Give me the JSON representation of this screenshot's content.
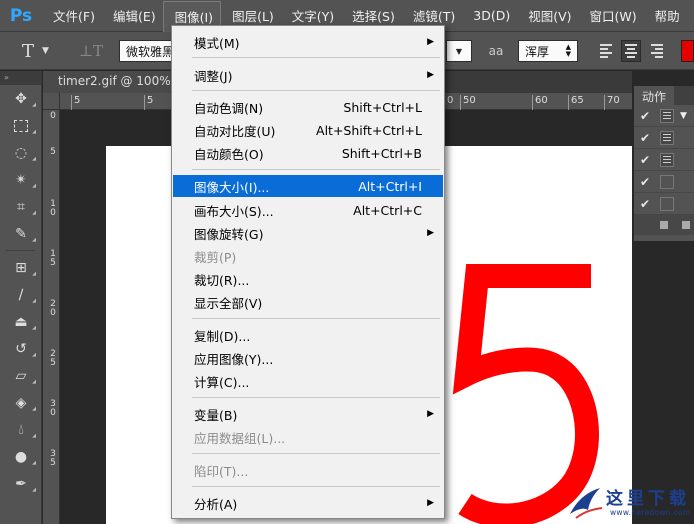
{
  "app": {
    "logo": "Ps"
  },
  "menubar": {
    "items": [
      "文件(F)",
      "编辑(E)",
      "图像(I)",
      "图层(L)",
      "文字(Y)",
      "选择(S)",
      "滤镜(T)",
      "3D(D)",
      "视图(V)",
      "窗口(W)",
      "帮助"
    ],
    "active_index": 2
  },
  "options_bar": {
    "tool_glyph": "T",
    "font_family": "微软雅黑",
    "antialias_label": "aa",
    "antialias_value": "浑厚",
    "text_color": "#e60000"
  },
  "document": {
    "tab_title": "timer2.gif @ 100%",
    "ruler_top_labels": [
      "5",
      "5",
      "5",
      "0",
      "50",
      "55",
      "60",
      "65",
      "70"
    ],
    "ruler_left_labels": [
      "0",
      "5",
      "1\n0",
      "1\n5",
      "2\n0",
      "2\n5",
      "3\n0",
      "3\n5"
    ],
    "canvas_digit": "5",
    "digit_color": "#ff0000"
  },
  "actions_panel": {
    "tab_label": "动作",
    "rows": [
      {
        "checked": true,
        "has_box": true,
        "expand": true
      },
      {
        "checked": true,
        "has_box": true,
        "expand": false
      },
      {
        "checked": true,
        "has_box": true,
        "expand": false
      },
      {
        "checked": true,
        "has_box": false,
        "expand": false
      },
      {
        "checked": true,
        "has_box": false,
        "expand": false
      }
    ]
  },
  "image_menu": {
    "items": [
      {
        "label": "模式(M)",
        "shortcut": "",
        "submenu": true,
        "disabled": false
      },
      {
        "label": "调整(J)",
        "shortcut": "",
        "submenu": true,
        "disabled": false
      },
      {
        "label": "自动色调(N)",
        "shortcut": "Shift+Ctrl+L",
        "submenu": false,
        "disabled": false
      },
      {
        "label": "自动对比度(U)",
        "shortcut": "Alt+Shift+Ctrl+L",
        "submenu": false,
        "disabled": false
      },
      {
        "label": "自动颜色(O)",
        "shortcut": "Shift+Ctrl+B",
        "submenu": false,
        "disabled": false
      },
      {
        "label": "图像大小(I)...",
        "shortcut": "Alt+Ctrl+I",
        "submenu": false,
        "disabled": false,
        "highlighted": true
      },
      {
        "label": "画布大小(S)...",
        "shortcut": "Alt+Ctrl+C",
        "submenu": false,
        "disabled": false
      },
      {
        "label": "图像旋转(G)",
        "shortcut": "",
        "submenu": true,
        "disabled": false
      },
      {
        "label": "裁剪(P)",
        "shortcut": "",
        "submenu": false,
        "disabled": true
      },
      {
        "label": "裁切(R)...",
        "shortcut": "",
        "submenu": false,
        "disabled": false
      },
      {
        "label": "显示全部(V)",
        "shortcut": "",
        "submenu": false,
        "disabled": false
      },
      {
        "label": "复制(D)...",
        "shortcut": "",
        "submenu": false,
        "disabled": false
      },
      {
        "label": "应用图像(Y)...",
        "shortcut": "",
        "submenu": false,
        "disabled": false
      },
      {
        "label": "计算(C)...",
        "shortcut": "",
        "submenu": false,
        "disabled": false
      },
      {
        "label": "变量(B)",
        "shortcut": "",
        "submenu": true,
        "disabled": false
      },
      {
        "label": "应用数据组(L)...",
        "shortcut": "",
        "submenu": false,
        "disabled": true
      },
      {
        "label": "陷印(T)...",
        "shortcut": "",
        "submenu": false,
        "disabled": true
      },
      {
        "label": "分析(A)",
        "shortcut": "",
        "submenu": true,
        "disabled": false
      }
    ]
  },
  "watermark": {
    "text": "这里下载",
    "url": "www.heredown.com"
  }
}
